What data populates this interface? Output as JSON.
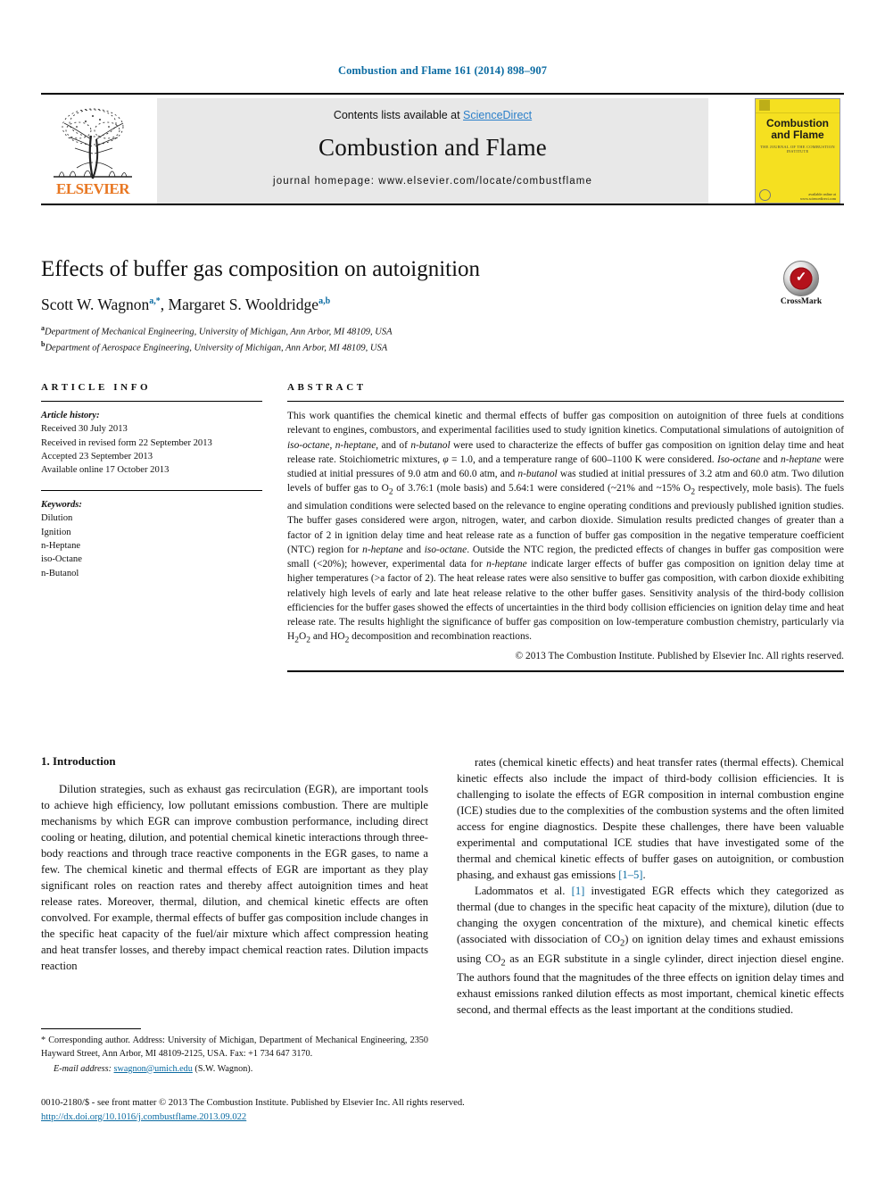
{
  "running_head": "Combustion and Flame 161 (2014) 898–907",
  "banner": {
    "contents_prefix": "Contents lists available at ",
    "sciencedirect": "ScienceDirect",
    "journal_title": "Combustion and Flame",
    "homepage": "journal homepage: www.elsevier.com/locate/combustflame",
    "publisher_word": "ELSEVIER",
    "cover": {
      "title_line1": "Combustion",
      "title_line2": "and Flame",
      "subtitle": "THE JOURNAL OF THE COMBUSTION INSTITUTE",
      "bottom_note": "available online at\nwww.sciencedirect.com"
    }
  },
  "article": {
    "title": "Effects of buffer gas composition on autoignition",
    "authors_html": "Scott W. Wagnon, Margaret S. Wooldridge",
    "author1": "Scott W. Wagnon",
    "author1_sup": "a,*",
    "author2": "Margaret S. Wooldridge",
    "author2_sup": "a,b",
    "affiliation_a_sup": "a",
    "affiliation_a": "Department of Mechanical Engineering, University of Michigan, Ann Arbor, MI 48109, USA",
    "affiliation_b_sup": "b",
    "affiliation_b": "Department of Aerospace Engineering, University of Michigan, Ann Arbor, MI 48109, USA",
    "crossmark_label": "CrossMark"
  },
  "article_info": {
    "heading": "ARTICLE INFO",
    "history_label": "Article history:",
    "history": [
      "Received 30 July 2013",
      "Received in revised form 22 September 2013",
      "Accepted 23 September 2013",
      "Available online 17 October 2013"
    ],
    "keywords_label": "Keywords:",
    "keywords": [
      "Dilution",
      "Ignition",
      "n-Heptane",
      "iso-Octane",
      "n-Butanol"
    ]
  },
  "abstract": {
    "heading": "ABSTRACT",
    "body": "This work quantifies the chemical kinetic and thermal effects of buffer gas composition on autoignition of three fuels at conditions relevant to engines, combustors, and experimental facilities used to study ignition kinetics. Computational simulations of autoignition of iso-octane, n-heptane, and of n-butanol were used to characterize the effects of buffer gas composition on ignition delay time and heat release rate. Stoichiometric mixtures, φ = 1.0, and a temperature range of 600–1100 K were considered. Iso-octane and n-heptane were studied at initial pressures of 9.0 atm and 60.0 atm, and n-butanol was studied at initial pressures of 3.2 atm and 60.0 atm. Two dilution levels of buffer gas to O2 of 3.76:1 (mole basis) and 5.64:1 were considered (~21% and ~15% O2 respectively, mole basis). The fuels and simulation conditions were selected based on the relevance to engine operating conditions and previously published ignition studies. The buffer gases considered were argon, nitrogen, water, and carbon dioxide. Simulation results predicted changes of greater than a factor of 2 in ignition delay time and heat release rate as a function of buffer gas composition in the negative temperature coefficient (NTC) region for n-heptane and iso-octane. Outside the NTC region, the predicted effects of changes in buffer gas composition were small (<20%); however, experimental data for n-heptane indicate larger effects of buffer gas composition on ignition delay time at higher temperatures (>a factor of 2). The heat release rates were also sensitive to buffer gas composition, with carbon dioxide exhibiting relatively high levels of early and late heat release relative to the other buffer gases. Sensitivity analysis of the third-body collision efficiencies for the buffer gases showed the effects of uncertainties in the third body collision efficiencies on ignition delay time and heat release rate. The results highlight the significance of buffer gas composition on low-temperature combustion chemistry, particularly via H2O2 and HO2 decomposition and recombination reactions.",
    "copyright": "© 2013 The Combustion Institute. Published by Elsevier Inc. All rights reserved."
  },
  "body": {
    "section_heading": "1. Introduction",
    "left_paragraph_1": "Dilution strategies, such as exhaust gas recirculation (EGR), are important tools to achieve high efficiency, low pollutant emissions combustion. There are multiple mechanisms by which EGR can improve combustion performance, including direct cooling or heating, dilution, and potential chemical kinetic interactions through three-body reactions and through trace reactive components in the EGR gases, to name a few. The chemical kinetic and thermal effects of EGR are important as they play significant roles on reaction rates and thereby affect autoignition times and heat release rates. Moreover, thermal, dilution, and chemical kinetic effects are often convolved. For example, thermal effects of buffer gas composition include changes in the specific heat capacity of the fuel/air mixture which affect compression heating and heat transfer losses, and thereby impact chemical reaction rates. Dilution impacts reaction",
    "right_paragraph_1_a": "rates (chemical kinetic effects) and heat transfer rates (thermal effects). Chemical kinetic effects also include the impact of third-body collision efficiencies. It is challenging to isolate the effects of EGR composition in internal combustion engine (ICE) studies due to the complexities of the combustion systems and the often limited access for engine diagnostics. Despite these challenges, there have been valuable experimental and computational ICE studies that have investigated some of the thermal and chemical kinetic effects of buffer gases on autoignition, or combustion phasing, and exhaust gas emissions ",
    "right_paragraph_1_ref": "[1–5]",
    "right_paragraph_1_b": ".",
    "right_paragraph_2_a": "Ladommatos et al. ",
    "right_paragraph_2_ref": "[1]",
    "right_paragraph_2_b": " investigated EGR effects which they categorized as thermal (due to changes in the specific heat capacity of the mixture), dilution (due to changing the oxygen concentration of the mixture), and chemical kinetic effects (associated with dissociation of CO2) on ignition delay times and exhaust emissions using CO2 as an EGR substitute in a single cylinder, direct injection diesel engine. The authors found that the magnitudes of the three effects on ignition delay times and exhaust emissions ranked dilution effects as most important, chemical kinetic effects second, and thermal effects as the least important at the conditions studied."
  },
  "footnote": {
    "corresponding": "* Corresponding author. Address: University of Michigan, Department of Mechanical Engineering, 2350 Hayward Street, Ann Arbor, MI 48109-2125, USA. Fax: +1 734 647 3170.",
    "email_label": "E-mail address:",
    "email": "swagnon@umich.edu",
    "email_suffix": " (S.W. Wagnon)."
  },
  "footer": {
    "issn_line": "0010-2180/$ - see front matter © 2013 The Combustion Institute. Published by Elsevier Inc. All rights reserved.",
    "doi": "http://dx.doi.org/10.1016/j.combustflame.2013.09.022"
  },
  "colors": {
    "link_blue": "#0b6ba2",
    "sciencedirect_blue": "#2a7fc9",
    "elsevier_orange": "#E87722",
    "cover_yellow": "#f5e020",
    "crossmark_red": "#b4121b"
  }
}
